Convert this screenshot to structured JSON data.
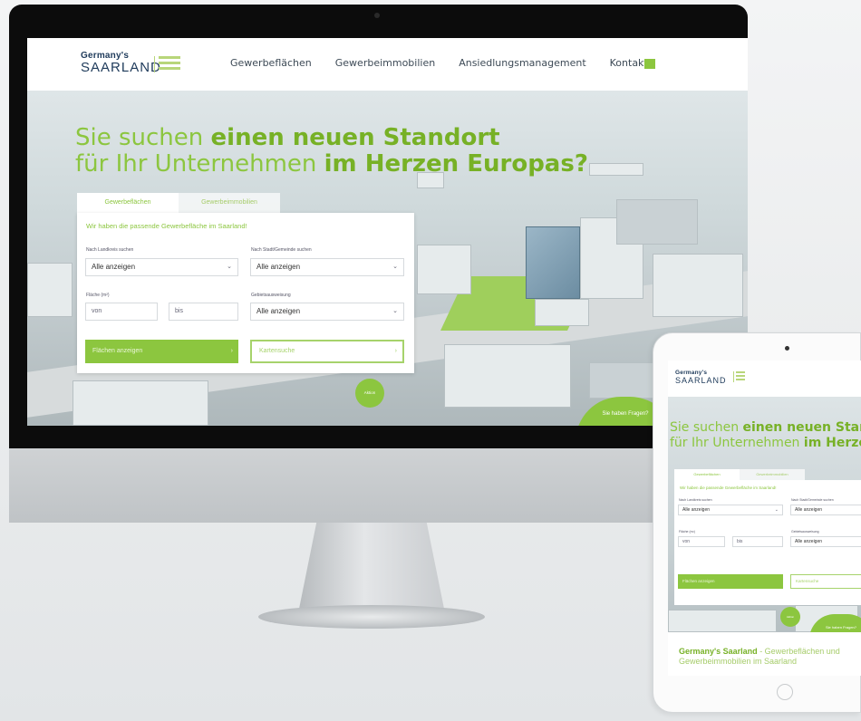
{
  "site": {
    "logo_top": "Germany's",
    "logo_main": "SAARLAND",
    "nav": [
      "Gewerbeflächen",
      "Gewerbeimmobilien",
      "Ansiedlungsmanagement",
      "Kontakt"
    ]
  },
  "hero": {
    "headline_line1_normal": "Sie suchen ",
    "headline_line1_bold": "einen neuen Standort",
    "headline_line2_normal": "für Ihr Unternehmen ",
    "headline_line2_bold": "im Herzen Europas?",
    "badge": "Aktion",
    "question": "Sie haben Fragen?"
  },
  "search": {
    "tabs": [
      "Gewerbeflächen",
      "Gewerbeimmobilien"
    ],
    "title": "Wir haben die passende Gewerbefläche im Saarland!",
    "label_kreis": "Nach Landkreis suchen",
    "select_kreis": "Alle anzeigen",
    "label_gemeinde": "Nach Stadt/Gemeinde suchen",
    "select_gemeinde": "Alle anzeigen",
    "label_flaeche": "Fläche (m²)",
    "placeholder_von": "von",
    "placeholder_bis": "bis",
    "label_gebiet": "Gebietsausweisung",
    "select_gebiet": "Alle anzeigen",
    "btn_show": "Flächen anzeigen",
    "btn_map": "Kartensuche"
  },
  "tablet": {
    "footer_bold": "Germany's Saarland",
    "footer_rest": " - Gewerbeflächen und Gewerbeimmobilien im Saarland"
  },
  "colors": {
    "accent_green": "#8cc63f",
    "dark_green": "#77b126",
    "logo_blue": "#1e3a5a"
  },
  "icons": {
    "chevron": "chevron-down-icon",
    "arrow": "chevron-right-icon"
  }
}
